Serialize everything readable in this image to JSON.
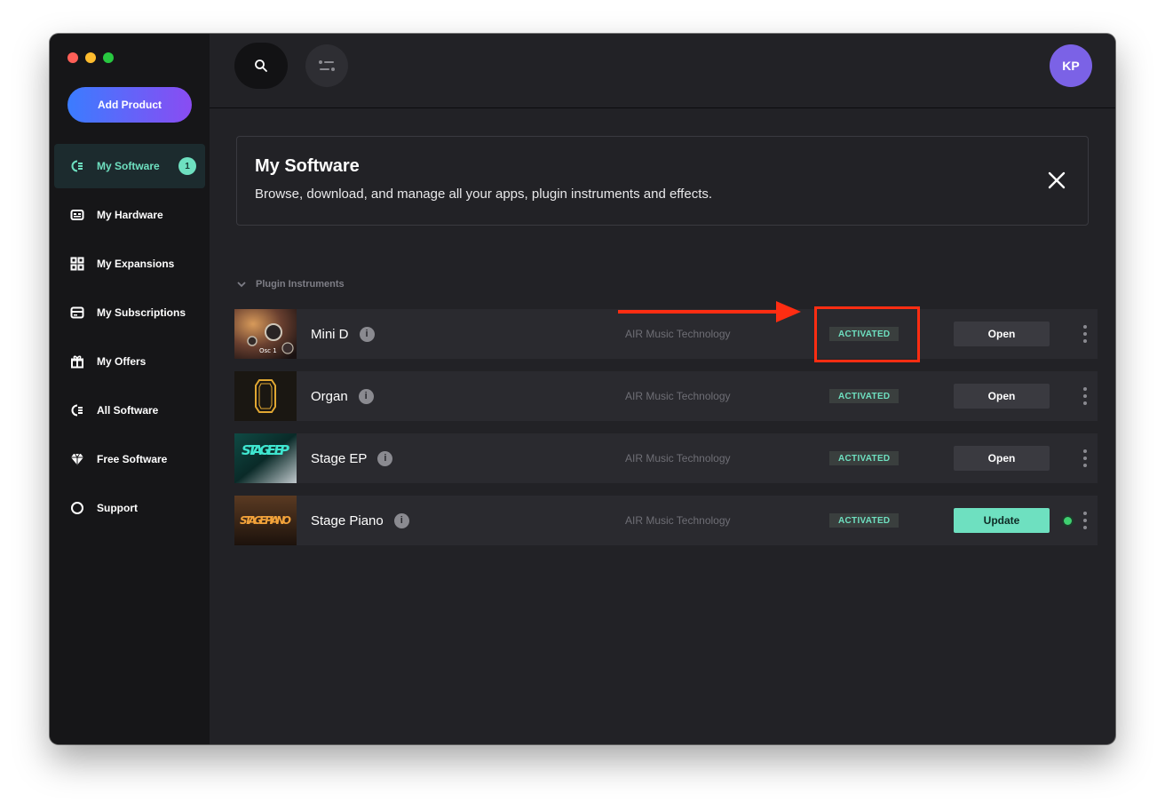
{
  "sidebar": {
    "add_product_label": "Add Product",
    "items": [
      {
        "label": "My Software",
        "icon": "software-icon",
        "badge": "1",
        "active": true
      },
      {
        "label": "My Hardware",
        "icon": "hardware-icon"
      },
      {
        "label": "My Expansions",
        "icon": "grid-icon"
      },
      {
        "label": "My Subscriptions",
        "icon": "subscription-icon"
      },
      {
        "label": "My Offers",
        "icon": "gift-icon"
      },
      {
        "label": "All Software",
        "icon": "software-icon"
      },
      {
        "label": "Free Software",
        "icon": "diamond-icon"
      },
      {
        "label": "Support",
        "icon": "circle-icon"
      }
    ]
  },
  "topbar": {
    "avatar_initials": "KP"
  },
  "banner": {
    "title": "My Software",
    "subtitle": "Browse, download, and manage all your apps, plugin instruments and effects."
  },
  "section": {
    "label": "Plugin Instruments"
  },
  "products": [
    {
      "name": "Mini D",
      "vendor": "AIR Music Technology",
      "status": "ACTIVATED",
      "action": "Open",
      "thumb_text": "Osc 1"
    },
    {
      "name": "Organ",
      "vendor": "AIR Music Technology",
      "status": "ACTIVATED",
      "action": "Open",
      "thumb_text": ""
    },
    {
      "name": "Stage EP",
      "vendor": "AIR Music Technology",
      "status": "ACTIVATED",
      "action": "Open",
      "thumb_text": "STAGE EP"
    },
    {
      "name": "Stage Piano",
      "vendor": "AIR Music Technology",
      "status": "ACTIVATED",
      "action": "Update",
      "thumb_text": "STAGE PIANO"
    }
  ],
  "colors": {
    "accent": "#6ee0c0",
    "annotation": "#ff2d12",
    "avatar": "#7b62e6"
  }
}
